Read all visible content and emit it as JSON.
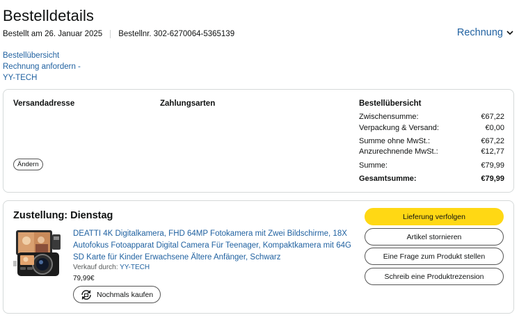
{
  "header": {
    "title": "Bestelldetails",
    "ordered_on": "Bestellt am 26. Januar 2025",
    "order_number": "Bestellnr. 302-6270064-5365139",
    "invoice_label": "Rechnung"
  },
  "links": [
    "Bestellübersicht",
    "Rechnung anfordern -",
    "YY-TECH"
  ],
  "summary_card": {
    "shipping_address_title": "Versandadresse",
    "payment_methods_title": "Zahlungsarten",
    "change_button": "Ändern",
    "order_summary_title": "Bestellübersicht",
    "rows": [
      {
        "label": "Zwischensumme:",
        "value": "€67,22"
      },
      {
        "label": "Verpackung & Versand:",
        "value": "€0,00"
      },
      {
        "label": "Summe ohne MwSt.:",
        "value": "€67,22"
      },
      {
        "label": "Anzurechnende MwSt.:",
        "value": "€12,77"
      },
      {
        "label": "Summe:",
        "value": "€79,99"
      },
      {
        "label": "Gesamtsumme:",
        "value": "€79,99"
      }
    ]
  },
  "delivery": {
    "title": "Zustellung: Dienstag",
    "product_title": "DEATTI 4K Digitalkamera, FHD 64MP Fotokamera mit Zwei Bildschirme, 18X Autofokus Fotoapparat Digital Camera Für Teenager, Kompaktkamera mit 64G SD Karte für Kinder Erwachsene Ältere Anfänger, Schwarz",
    "seller_prefix": "Verkauf durch:",
    "seller_name": "YY-TECH",
    "price": "79,99€",
    "buy_again": "Nochmals kaufen",
    "actions": {
      "track": "Lieferung verfolgen",
      "cancel": "Artikel stornieren",
      "question": "Eine Frage zum Produkt stellen",
      "review": "Schreib eine Produktrezension"
    }
  },
  "colors": {
    "link": "#2162a1",
    "primary_button": "#ffd814",
    "border": "#d5d9d9"
  }
}
